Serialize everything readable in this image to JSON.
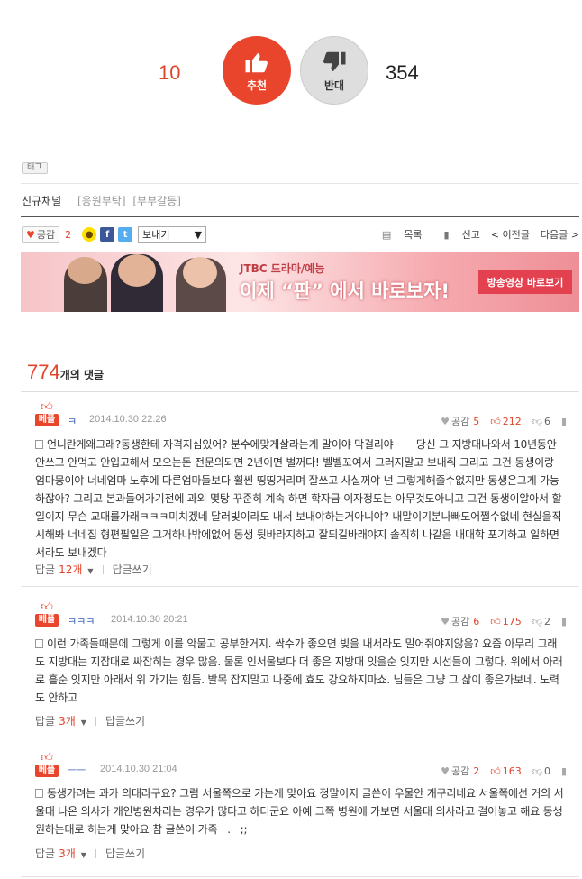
{
  "vote": {
    "up_count": "10",
    "up_label": "추천",
    "down_label": "반대",
    "down_count": "354"
  },
  "tag_label": "태그",
  "channel": {
    "name": "신규채널",
    "categories": [
      "[응원부탁]",
      "[부부갈등]"
    ]
  },
  "action_bar": {
    "like_label": "공감",
    "like_count": "2",
    "send_label": "보내기",
    "list_label": "목록",
    "report_label": "신고",
    "prev_label": "< 이전글",
    "next_label": "다음글 >"
  },
  "banner": {
    "subtitle": "JTBC 드라마/예능",
    "title": "이제 “판” 에서 바로보자!",
    "button": "방송영상 바로보기"
  },
  "comments_header": {
    "count": "774",
    "suffix": "개의 댓글"
  },
  "comments": [
    {
      "badge": "베플",
      "user": "ㅋ",
      "date": "2014.10.30 22:26",
      "like_label": "공감",
      "likes": "5",
      "up": "212",
      "down": "6",
      "body": "언니란게왜그래?동생한테 자격지심있어? 분수에맞게살라는게 말이야 막걸리야 ㅡㅡ당신 그 지방대나와서 10년동안 안쓰고 안먹고 안입고해서 모으는돈 전문의되면 2년이면 벌꺼다! 벨벨꼬여서 그러지말고 보내줘 그리고 그건 동생이랑 엄마뭉이야 너네엄마 노후에 다른엄마들보다 훨씬 띵띵거리며 잘쓰고 사실꺼야 넌 그렇게해줄수없지만 동생은그게 가능하잖아? 그리고 본과들어가기전에 과외 몇탕 꾸준히 계속 하면 학자금 이자정도는 아무것도아니고 그건 동생이알아서 할일이지 무슨 교대를가래ㅋㅋㅋ미치겠네 달러빚이라도 내서 보내야하는거아니야? 내말이기분나빠도어쩔수없네 현실을직시해봐 너네집 형편필일은 그거하나밖에없어 동생 뒷바라지하고 잘되길바래야지 솔직히 나같음 내대학 포기하고 일하면서라도 보내겠다",
      "reply_label": "답글",
      "reply_count": "12개",
      "write_label": "답글쓰기"
    },
    {
      "badge": "베플",
      "user": "ㅋㅋㅋ",
      "date": "2014.10.30 20:21",
      "like_label": "공감",
      "likes": "6",
      "up": "175",
      "down": "2",
      "body": "이런 가족들때문에 그렇게 이를 악물고 공부한거지. 싹수가 좋으면 빚을 내서라도 밀어줘야지않음? 요즘 아무리 그래도 지방대는 지잡대로 싸잡히는 경우 많음. 물론 인서울보다 더 좋은 지방대 잇을순 잇지만 시선들이 그렇다. 위에서 아래로 흘순 잇지만 아래서 위 가기는 힘듬. 발목 잡지말고 나중에 효도 강요하지마쇼. 님들은 그냥 그 삶이 좋은가보네. 노력도 안하고",
      "reply_label": "답글",
      "reply_count": "3개",
      "write_label": "답글쓰기"
    },
    {
      "badge": "베플",
      "user": "ㅡㅡ",
      "date": "2014.10.30 21:04",
      "like_label": "공감",
      "likes": "2",
      "up": "163",
      "down": "0",
      "body": "동생가려는 과가 의대라구요? 그럼 서울쪽으로 가는게 맞아요 정말이지 글쓴이 우물안 개구리네요 서울쪽에선 거의 서울대 나온 의사가 개인병원차리는 경우가 많다고 하더군요 아예 그쪽 병원에 가보면 서울대 의사라고 걸어놓고 해요 동생 원하는대로 히는게 맞아요 참 글쓴이 가족ㅡ.ㅡ;;",
      "reply_label": "답글",
      "reply_count": "3개",
      "write_label": "답글쓰기"
    }
  ]
}
